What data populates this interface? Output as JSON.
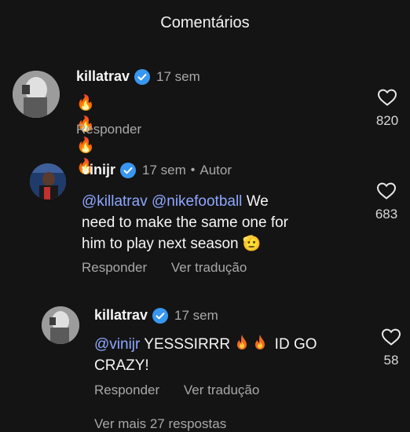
{
  "header": {
    "title": "Comentários"
  },
  "comments": [
    {
      "username": "killatrav",
      "time": "17 sem",
      "text": "🔥🔥🔥🔥",
      "reply_label": "Responder",
      "likes": "820"
    },
    {
      "username": "vinijr",
      "time": "17 sem",
      "author_label": "Autor",
      "mention1": "@killatrav",
      "mention2": "@nikefootball",
      "text_line1_tail": "We",
      "text_line2": "need to make the same one for",
      "text_line3": "him to play next season",
      "text_emoji": "🫡",
      "reply_label": "Responder",
      "translate_label": "Ver tradução",
      "likes": "683"
    },
    {
      "username": "killatrav",
      "time": "17 sem",
      "mention": "@vinijr",
      "text_part1": "YESSSIRRR",
      "text_part2": "ID GO",
      "text_line2": "CRAZY!",
      "reply_label": "Responder",
      "translate_label": "Ver tradução",
      "likes": "58"
    }
  ],
  "footer": {
    "more_replies": "Ver mais 27 respostas"
  },
  "colors": {
    "background": "#141414",
    "verified": "#3897f0",
    "mention": "#8ea7ff",
    "secondary_text": "#a8a8a8"
  }
}
